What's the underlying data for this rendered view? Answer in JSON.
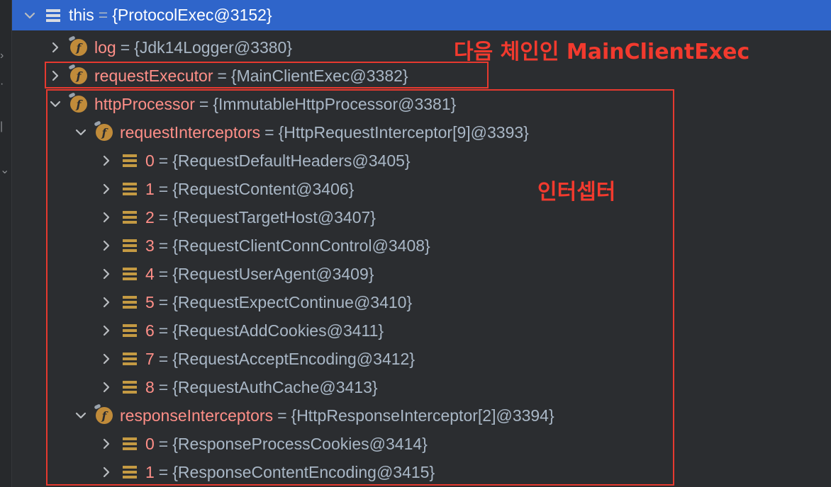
{
  "tree": [
    {
      "indent": 0,
      "expanded": true,
      "icon": "stack",
      "name": "this",
      "value": "{ProtocolExec@3152}",
      "selected": true
    },
    {
      "indent": 1,
      "expanded": false,
      "icon": "field",
      "name": "log",
      "value": "{Jdk14Logger@3380}"
    },
    {
      "indent": 1,
      "expanded": false,
      "icon": "field",
      "name": "requestExecutor",
      "value": "{MainClientExec@3382}"
    },
    {
      "indent": 1,
      "expanded": true,
      "icon": "field",
      "name": "httpProcessor",
      "value": "{ImmutableHttpProcessor@3381}"
    },
    {
      "indent": 2,
      "expanded": true,
      "icon": "field",
      "name": "requestInterceptors",
      "value": "{HttpRequestInterceptor[9]@3393}"
    },
    {
      "indent": 3,
      "expanded": false,
      "icon": "stack",
      "name": "0",
      "value": "{RequestDefaultHeaders@3405}"
    },
    {
      "indent": 3,
      "expanded": false,
      "icon": "stack",
      "name": "1",
      "value": "{RequestContent@3406}"
    },
    {
      "indent": 3,
      "expanded": false,
      "icon": "stack",
      "name": "2",
      "value": "{RequestTargetHost@3407}"
    },
    {
      "indent": 3,
      "expanded": false,
      "icon": "stack",
      "name": "3",
      "value": "{RequestClientConnControl@3408}"
    },
    {
      "indent": 3,
      "expanded": false,
      "icon": "stack",
      "name": "4",
      "value": "{RequestUserAgent@3409}"
    },
    {
      "indent": 3,
      "expanded": false,
      "icon": "stack",
      "name": "5",
      "value": "{RequestExpectContinue@3410}"
    },
    {
      "indent": 3,
      "expanded": false,
      "icon": "stack",
      "name": "6",
      "value": "{RequestAddCookies@3411}"
    },
    {
      "indent": 3,
      "expanded": false,
      "icon": "stack",
      "name": "7",
      "value": "{RequestAcceptEncoding@3412}"
    },
    {
      "indent": 3,
      "expanded": false,
      "icon": "stack",
      "name": "8",
      "value": "{RequestAuthCache@3413}"
    },
    {
      "indent": 2,
      "expanded": true,
      "icon": "field",
      "name": "responseInterceptors",
      "value": "{HttpResponseInterceptor[2]@3394}"
    },
    {
      "indent": 3,
      "expanded": false,
      "icon": "stack",
      "name": "0",
      "value": "{ResponseProcessCookies@3414}"
    },
    {
      "indent": 3,
      "expanded": false,
      "icon": "stack",
      "name": "1",
      "value": "{ResponseContentEncoding@3415}"
    }
  ],
  "annotations": {
    "main_client_exec": "다음 체인인 MainClientExec",
    "interceptors": "인터셉터"
  },
  "colors": {
    "background": "#2b2d30",
    "selection": "#2f65ca",
    "field_name": "#ff8f88",
    "value": "#a9b7c6",
    "annotation": "#e6392f"
  }
}
